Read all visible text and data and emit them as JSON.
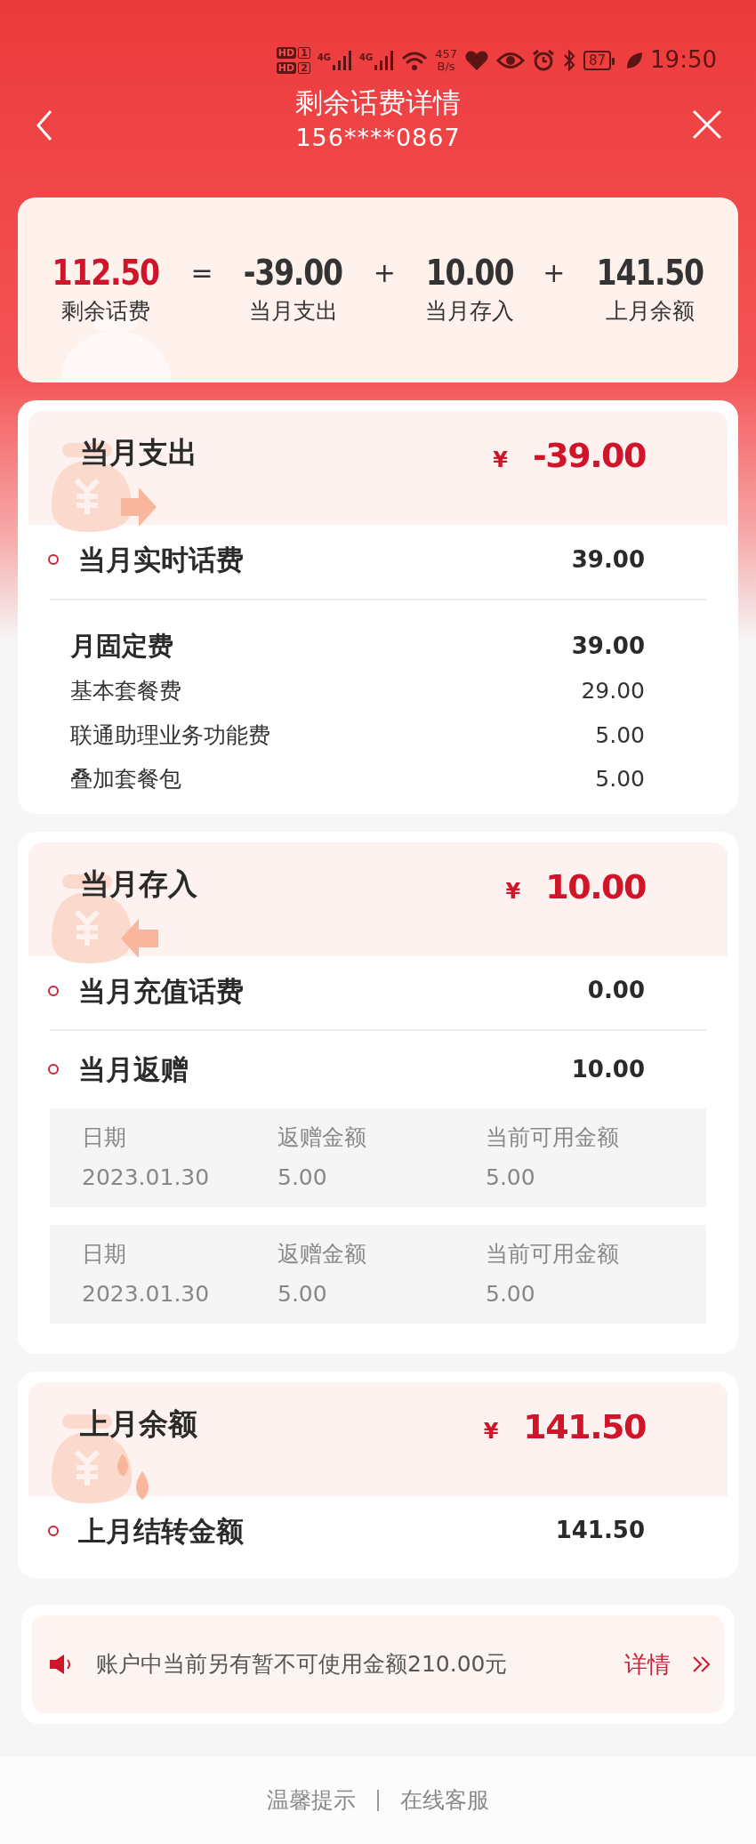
{
  "status_bar": {
    "sims": [
      {
        "hd": "HD",
        "slot": "1"
      },
      {
        "hd": "HD",
        "slot": "2"
      }
    ],
    "networks": [
      {
        "type": "4G"
      },
      {
        "type": "4G"
      }
    ],
    "speed_value": "457",
    "speed_unit": "B/s",
    "battery": "87",
    "time": "19:50"
  },
  "header": {
    "title": "剩余话费详情",
    "phone": "156****0867"
  },
  "summary": [
    {
      "kind": "term",
      "value": "112.50",
      "label": "剩余话费",
      "highlight": true
    },
    {
      "kind": "operator",
      "symbol": "="
    },
    {
      "kind": "term",
      "value": "-39.00",
      "label": "当月支出",
      "highlight": false
    },
    {
      "kind": "operator",
      "symbol": "+"
    },
    {
      "kind": "term",
      "value": "10.00",
      "label": "当月存入",
      "highlight": false
    },
    {
      "kind": "operator",
      "symbol": "+"
    },
    {
      "kind": "term",
      "value": "141.50",
      "label": "上月余额",
      "highlight": false
    }
  ],
  "sections": [
    {
      "title": "当月支出",
      "currency": "¥",
      "amount": "-39.00",
      "rows": [
        {
          "kind": "main",
          "label": "当月实时话费",
          "value": "39.00"
        },
        {
          "kind": "subtotal",
          "label": "月固定费",
          "value": "39.00"
        },
        {
          "kind": "detail",
          "label": "基本套餐费",
          "value": "29.00"
        },
        {
          "kind": "detail",
          "label": "联通助理业务功能费",
          "value": "5.00"
        },
        {
          "kind": "detail",
          "label": "叠加套餐包",
          "value": "5.00"
        }
      ]
    },
    {
      "title": "当月存入",
      "currency": "¥",
      "amount": "10.00",
      "rows": [
        {
          "kind": "main",
          "label": "当月充值话费",
          "value": "0.00"
        },
        {
          "kind": "main",
          "label": "当月返赠",
          "value": "10.00"
        },
        {
          "kind": "records",
          "entries": [
            {
              "cells": [
                {
                  "label": "日期",
                  "value": "2023.01.30"
                },
                {
                  "label": "返赠金额",
                  "value": "5.00"
                },
                {
                  "label": "当前可用金额",
                  "value": "5.00"
                }
              ]
            },
            {
              "cells": [
                {
                  "label": "日期",
                  "value": "2023.01.30"
                },
                {
                  "label": "返赠金额",
                  "value": "5.00"
                },
                {
                  "label": "当前可用金额",
                  "value": "5.00"
                }
              ]
            }
          ]
        }
      ]
    },
    {
      "title": "上月余额",
      "currency": "¥",
      "amount": "141.50",
      "rows": [
        {
          "kind": "main",
          "label": "上月结转金额",
          "value": "141.50"
        }
      ]
    }
  ],
  "notice": {
    "text": "账户中当前另有暂不可使用金额210.00元",
    "link": "详情"
  },
  "footer": [
    "温馨提示",
    "在线客服"
  ]
}
